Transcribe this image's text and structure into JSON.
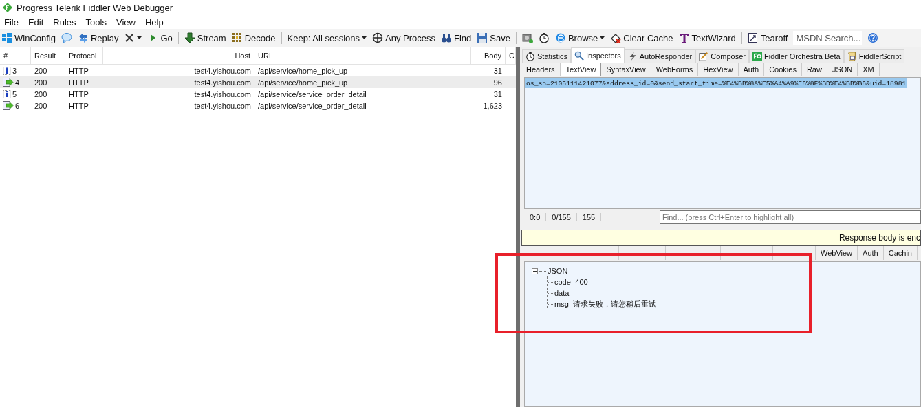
{
  "window": {
    "title": "Progress Telerik Fiddler Web Debugger"
  },
  "menu": [
    {
      "label": "File"
    },
    {
      "label": "Edit"
    },
    {
      "label": "Rules"
    },
    {
      "label": "Tools"
    },
    {
      "label": "View"
    },
    {
      "label": "Help"
    }
  ],
  "toolbar": [
    {
      "kind": "button",
      "label": "WinConfig"
    },
    {
      "kind": "icon"
    },
    {
      "kind": "button",
      "label": "Replay"
    },
    {
      "kind": "menu"
    },
    {
      "kind": "button",
      "label": "Go"
    },
    {
      "kind": "separator"
    },
    {
      "kind": "button",
      "label": "Stream"
    },
    {
      "kind": "button",
      "label": "Decode"
    },
    {
      "kind": "separator"
    },
    {
      "kind": "menu",
      "label": "Keep: All sessions"
    },
    {
      "kind": "button",
      "label": "Any Process"
    },
    {
      "kind": "button",
      "label": "Find"
    },
    {
      "kind": "button",
      "label": "Save"
    },
    {
      "kind": "separator"
    },
    {
      "kind": "icon"
    },
    {
      "kind": "icon"
    },
    {
      "kind": "menu",
      "label": "Browse"
    },
    {
      "kind": "button",
      "label": "Clear Cache"
    },
    {
      "kind": "button",
      "label": "TextWizard"
    },
    {
      "kind": "separator"
    },
    {
      "kind": "button",
      "label": "Tearoff"
    },
    {
      "kind": "search",
      "label": "MSDN Search..."
    },
    {
      "kind": "icon"
    }
  ],
  "sessions": {
    "columns": [
      "#",
      "Result",
      "Protocol",
      "Host",
      "URL",
      "Body",
      "C"
    ],
    "rows": [
      {
        "kind": "info",
        "id": "3",
        "result": "200",
        "protocol": "HTTP",
        "host": "test4.yishou.com",
        "url": "/api/service/home_pick_up",
        "body": "31",
        "selected": false
      },
      {
        "kind": "response",
        "id": "4",
        "result": "200",
        "protocol": "HTTP",
        "host": "test4.yishou.com",
        "url": "/api/service/home_pick_up",
        "body": "96",
        "selected": true
      },
      {
        "kind": "info",
        "id": "5",
        "result": "200",
        "protocol": "HTTP",
        "host": "test4.yishou.com",
        "url": "/api/service/service_order_detail",
        "body": "31",
        "selected": false
      },
      {
        "kind": "response",
        "id": "6",
        "result": "200",
        "protocol": "HTTP",
        "host": "test4.yishou.com",
        "url": "/api/service/service_order_detail",
        "body": "1,623",
        "selected": false
      }
    ]
  },
  "main_tabs": [
    {
      "label": "Statistics",
      "selected": false
    },
    {
      "label": "Inspectors",
      "selected": true
    },
    {
      "label": "AutoResponder",
      "selected": false
    },
    {
      "label": "Composer",
      "selected": false
    },
    {
      "label": "Fiddler Orchestra Beta",
      "selected": false
    },
    {
      "label": "FiddlerScript",
      "selected": false
    }
  ],
  "request_tabs": [
    {
      "label": "Headers",
      "selected": false
    },
    {
      "label": "TextView",
      "selected": true
    },
    {
      "label": "SyntaxView",
      "selected": false
    },
    {
      "label": "WebForms",
      "selected": false
    },
    {
      "label": "HexView",
      "selected": false
    },
    {
      "label": "Auth",
      "selected": false
    },
    {
      "label": "Cookies",
      "selected": false
    },
    {
      "label": "Raw",
      "selected": false
    },
    {
      "label": "JSON",
      "selected": false
    },
    {
      "label": "XM",
      "selected": false
    }
  ],
  "request_body": "os_sn=2105111421077&address_id=0&send_start_time=%E4%BB%8A%E5%A4%A9%E6%8F%BD%E4%BB%B6&uid=18981",
  "status": {
    "position": "0:0",
    "selection": "0/155",
    "length": "155",
    "find_placeholder": "Find... (press Ctrl+Enter to highlight all)"
  },
  "response_banner": "Response body is enc",
  "response_tabs": [
    {
      "selected": false
    },
    {
      "selected": false
    },
    {
      "selected": false
    },
    {
      "selected": false
    },
    {
      "selected": false
    },
    {
      "selected": false
    },
    {
      "label": "WebView",
      "selected": false
    },
    {
      "label": "Auth",
      "selected": false
    },
    {
      "label": "Cachin",
      "selected": false
    }
  ],
  "tree": [
    {
      "label": "JSON",
      "expanded": true,
      "children": [
        {
          "label": "code=400"
        },
        {
          "label": "data"
        },
        {
          "label": "msg=请求失败，请您稍后重试"
        }
      ]
    }
  ]
}
